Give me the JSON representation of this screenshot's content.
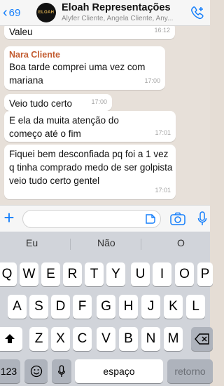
{
  "header": {
    "back_count": "69",
    "avatar_text": "ELOAH",
    "title": "Eloah Representações",
    "subtitle": "Alyfer Cliente, Angela Cliente, Any..."
  },
  "messages": [
    {
      "text": "Valeu",
      "time": "16:12"
    },
    {
      "sender": "Nara Cliente",
      "text": "Boa tarde comprei uma vez com mariana",
      "time": "17:00"
    },
    {
      "text": "Veio tudo certo",
      "time": "17:00"
    },
    {
      "text": "E ela da muita atenção do começo até o fim",
      "time": "17:01"
    },
    {
      "text": "Fiquei bem desconfiada pq foi a 1 vez q tinha comprado medo de ser golpista veio tudo certo gentel",
      "time": "17:01"
    }
  ],
  "keyboard": {
    "suggestions": [
      "Eu",
      "Não",
      "O"
    ],
    "row1": [
      "Q",
      "W",
      "E",
      "R",
      "T",
      "Y",
      "U",
      "I",
      "O",
      "P"
    ],
    "row2": [
      "A",
      "S",
      "D",
      "F",
      "G",
      "H",
      "J",
      "K",
      "L"
    ],
    "row3": [
      "Z",
      "X",
      "C",
      "V",
      "B",
      "N",
      "M"
    ],
    "numbers_label": "123",
    "space_label": "espaço",
    "return_label": "retorno"
  },
  "icons": {
    "back": "chevron-left-icon",
    "call": "phone-plus-icon",
    "attach": "plus-icon",
    "sticker": "sticker-icon",
    "camera": "camera-icon",
    "mic": "microphone-icon",
    "shift": "shift-icon",
    "delete": "backspace-icon",
    "emoji": "emoji-icon",
    "dictation": "dictation-microphone-icon"
  },
  "colors": {
    "accent": "#147efb",
    "sender_name": "#c25b2f",
    "chat_background": "#e7e0d9"
  }
}
